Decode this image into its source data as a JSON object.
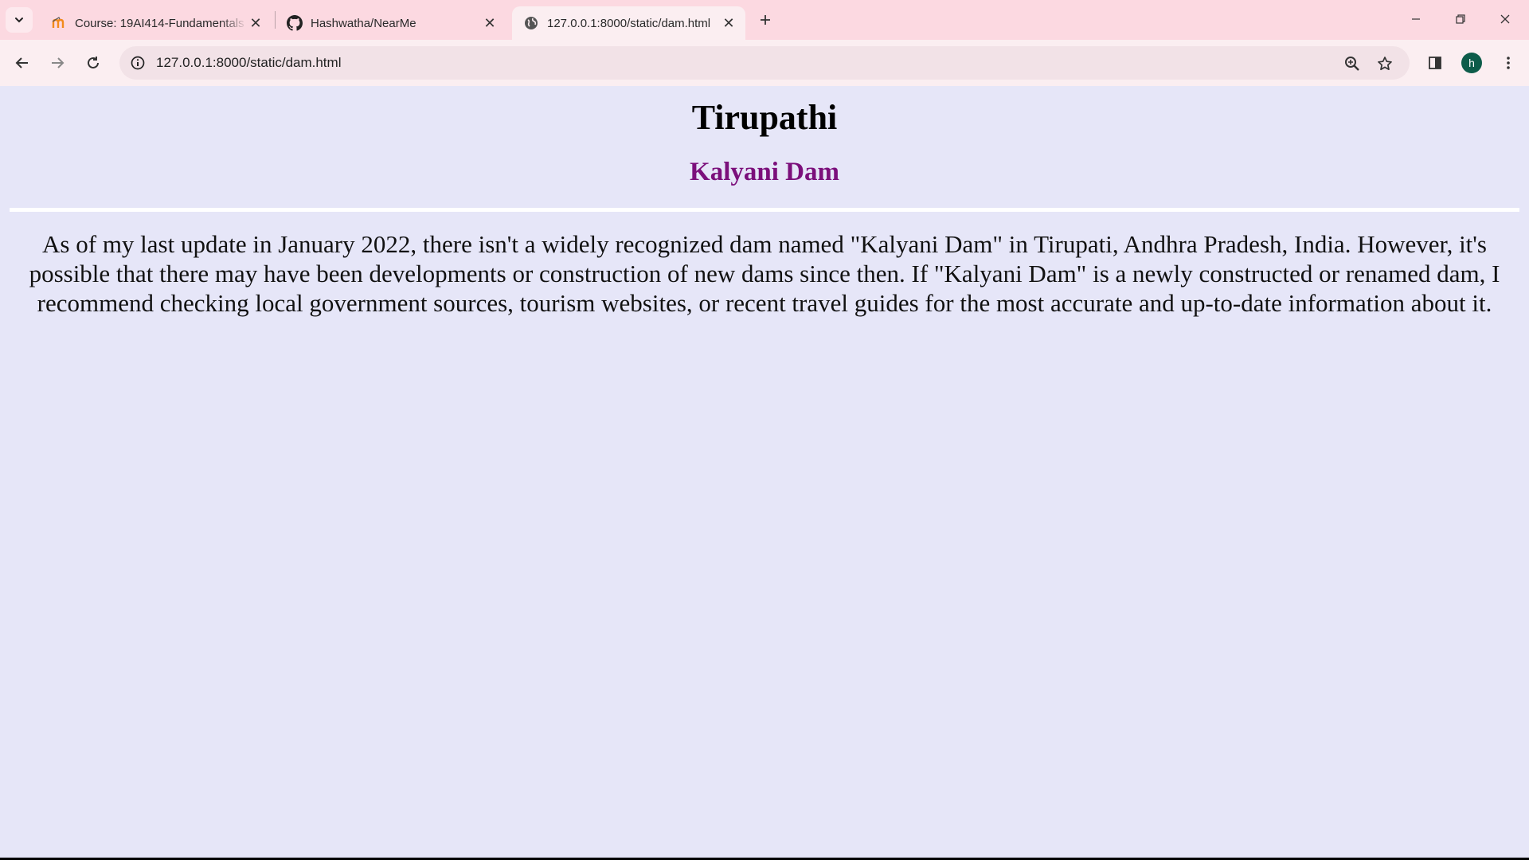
{
  "browser": {
    "tabs": [
      {
        "title": "Course: 19AI414-Fundamentals",
        "favicon": "moodle-icon",
        "active": false
      },
      {
        "title": "Hashwatha/NearMe",
        "favicon": "github-icon",
        "active": false
      },
      {
        "title": "127.0.0.1:8000/static/dam.html",
        "favicon": "globe-icon",
        "active": true
      }
    ],
    "url": "127.0.0.1:8000/static/dam.html",
    "profile_initial": "h",
    "colors": {
      "tabstrip": "#fcd9e1",
      "toolbar": "#fbeef1",
      "avatar": "#0d5c4a"
    }
  },
  "page": {
    "heading": "Tirupathi",
    "subheading": "Kalyani Dam",
    "body": "As of my last update in January 2022, there isn't a widely recognized dam named \"Kalyani Dam\" in Tirupati, Andhra Pradesh, India. However, it's possible that there may have been developments or construction of new dams since then. If \"Kalyani Dam\" is a newly constructed or renamed dam, I recommend checking local government sources, tourism websites, or recent travel guides for the most accurate and up-to-date information about it.",
    "colors": {
      "background": "#e6e6f8",
      "subheading": "#7b0f7b"
    }
  }
}
